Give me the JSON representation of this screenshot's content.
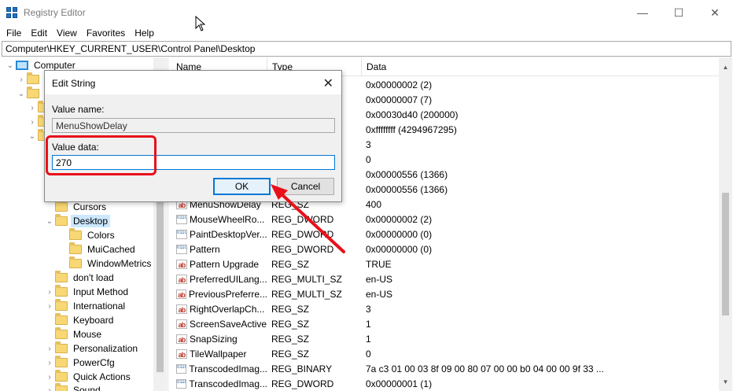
{
  "window": {
    "title": "Registry Editor",
    "minimize": "—",
    "maximize": "☐",
    "close": "✕"
  },
  "menu": [
    "File",
    "Edit",
    "View",
    "Favorites",
    "Help"
  ],
  "address": "Computer\\HKEY_CURRENT_USER\\Control Panel\\Desktop",
  "tree": {
    "root": "Computer",
    "items": [
      {
        "label": "Cursors",
        "chevron": ""
      },
      {
        "label": "Desktop",
        "chevron": "⌄",
        "selected": true
      },
      {
        "label": "Colors",
        "chevron": ""
      },
      {
        "label": "MuiCached",
        "chevron": ""
      },
      {
        "label": "WindowMetrics",
        "chevron": ""
      },
      {
        "label": "don't load",
        "chevron": ""
      },
      {
        "label": "Input Method",
        "chevron": "›"
      },
      {
        "label": "International",
        "chevron": "›"
      },
      {
        "label": "Keyboard",
        "chevron": ""
      },
      {
        "label": "Mouse",
        "chevron": ""
      },
      {
        "label": "Personalization",
        "chevron": "›"
      },
      {
        "label": "PowerCfg",
        "chevron": "›"
      },
      {
        "label": "Quick Actions",
        "chevron": "›"
      },
      {
        "label": "Sound",
        "chevron": "›"
      }
    ]
  },
  "columns": {
    "name": "Name",
    "type": "Type",
    "data": "Data"
  },
  "rows": [
    {
      "name": "",
      "type": "",
      "data": "0x00000002 (2)",
      "icon": "none"
    },
    {
      "name": "",
      "type": "",
      "data": "0x00000007 (7)",
      "icon": "none"
    },
    {
      "name": "",
      "type": "",
      "data": "0x00030d40 (200000)",
      "icon": "none"
    },
    {
      "name": "",
      "type": "",
      "data": "0xffffffff (4294967295)",
      "icon": "none"
    },
    {
      "name": "",
      "type": "",
      "data": "3",
      "icon": "none"
    },
    {
      "name": "",
      "type": "",
      "data": "0",
      "icon": "none"
    },
    {
      "name": "",
      "type": "",
      "data": "0x00000556 (1366)",
      "icon": "none"
    },
    {
      "name": "",
      "type": "",
      "data": "0x00000556 (1366)",
      "icon": "none"
    },
    {
      "name": "MenuShowDelay",
      "type": "REG_SZ",
      "data": "400",
      "icon": "ab"
    },
    {
      "name": "MouseWheelRo...",
      "type": "REG_DWORD",
      "data": "0x00000002 (2)",
      "icon": "bin"
    },
    {
      "name": "PaintDesktopVer...",
      "type": "REG_DWORD",
      "data": "0x00000000 (0)",
      "icon": "bin"
    },
    {
      "name": "Pattern",
      "type": "REG_DWORD",
      "data": "0x00000000 (0)",
      "icon": "bin"
    },
    {
      "name": "Pattern Upgrade",
      "type": "REG_SZ",
      "data": "TRUE",
      "icon": "ab"
    },
    {
      "name": "PreferredUILang...",
      "type": "REG_MULTI_SZ",
      "data": "en-US",
      "icon": "ab"
    },
    {
      "name": "PreviousPreferre...",
      "type": "REG_MULTI_SZ",
      "data": "en-US",
      "icon": "ab"
    },
    {
      "name": "RightOverlapCh...",
      "type": "REG_SZ",
      "data": "3",
      "icon": "ab"
    },
    {
      "name": "ScreenSaveActive",
      "type": "REG_SZ",
      "data": "1",
      "icon": "ab"
    },
    {
      "name": "SnapSizing",
      "type": "REG_SZ",
      "data": "1",
      "icon": "ab"
    },
    {
      "name": "TileWallpaper",
      "type": "REG_SZ",
      "data": "0",
      "icon": "ab"
    },
    {
      "name": "TranscodedImag...",
      "type": "REG_BINARY",
      "data": "7a c3 01 00 03 8f 09 00 80 07 00 00 b0 04 00 00 9f 33 ...",
      "icon": "bin"
    },
    {
      "name": "TranscodedImag...",
      "type": "REG_DWORD",
      "data": "0x00000001 (1)",
      "icon": "bin"
    }
  ],
  "dialog": {
    "title": "Edit String",
    "value_name_label": "Value name:",
    "value_name": "MenuShowDelay",
    "value_data_label": "Value data:",
    "value_data": "270",
    "ok_label": "OK",
    "cancel_label": "Cancel"
  },
  "annotation": {
    "color": "#e8101a"
  }
}
